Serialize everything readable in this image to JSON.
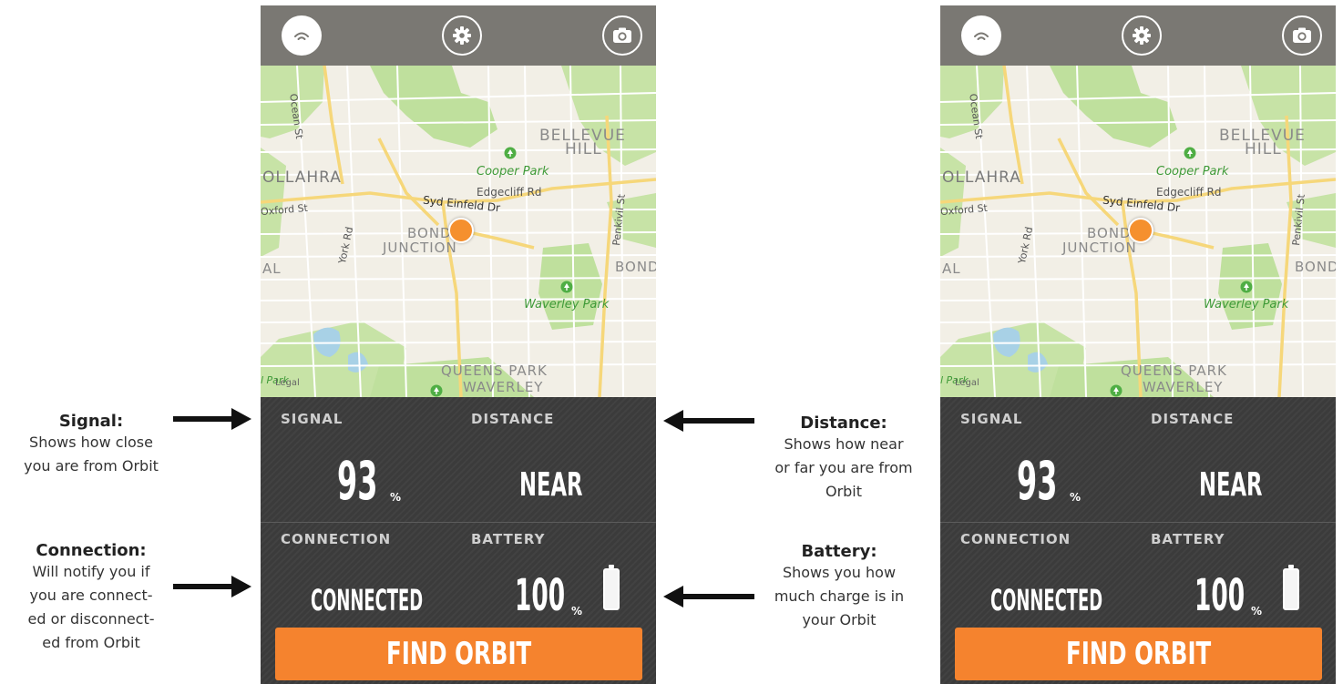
{
  "annotations": {
    "signal": {
      "title": "Signal:",
      "lines": [
        "Shows how close",
        "you are from Orbit"
      ]
    },
    "connection": {
      "title": "Connection:",
      "lines": [
        "Will notify you if",
        "you are connect-",
        "ed or disconnect-",
        "ed from Orbit"
      ]
    },
    "distance": {
      "title": "Distance:",
      "lines": [
        "Shows how near",
        "or far you are from",
        "Orbit"
      ]
    },
    "battery": {
      "title": "Battery:",
      "lines": [
        "Shows you how",
        "much charge is in",
        "your Orbit"
      ]
    }
  },
  "map": {
    "labels": {
      "ocean_st": "Ocean St",
      "bellevue": "BELLEVUE",
      "hill": "HILL",
      "cooper_park": "Cooper Park",
      "ollahra": "OLLAHRA",
      "edgecliff_rd": "Edgecliff Rd",
      "oxford_st": "Oxford St",
      "syd_einfeld_dr": "Syd Einfeld Dr",
      "bond": "BOND",
      "junction": "JUNCTION",
      "york_rd": "York Rd",
      "penkivil_st": "Penkivil St",
      "bond_right": "BOND",
      "al": "AL",
      "waverley_park": "Waverley Park",
      "queens_park": "QUEENS PARK",
      "waverley": "WAVERLEY",
      "park_legal": "l Park",
      "legal": "Legal"
    }
  },
  "panel": {
    "signal_label": "SIGNAL",
    "signal_value": "93",
    "signal_unit": "%",
    "distance_label": "DISTANCE",
    "distance_value": "NEAR",
    "connection_label": "CONNECTION",
    "connection_value": "CONNECTED",
    "battery_label": "BATTERY",
    "battery_value": "100",
    "battery_unit": "%",
    "find_button": "FIND ORBIT"
  },
  "colors": {
    "accent_orange": "#f5832e",
    "topbar": "#7a7873",
    "panel": "#3d3d3d"
  },
  "icons": {
    "topbar_left": "signal-icon",
    "topbar_center": "gear-icon",
    "topbar_right": "camera-icon"
  }
}
